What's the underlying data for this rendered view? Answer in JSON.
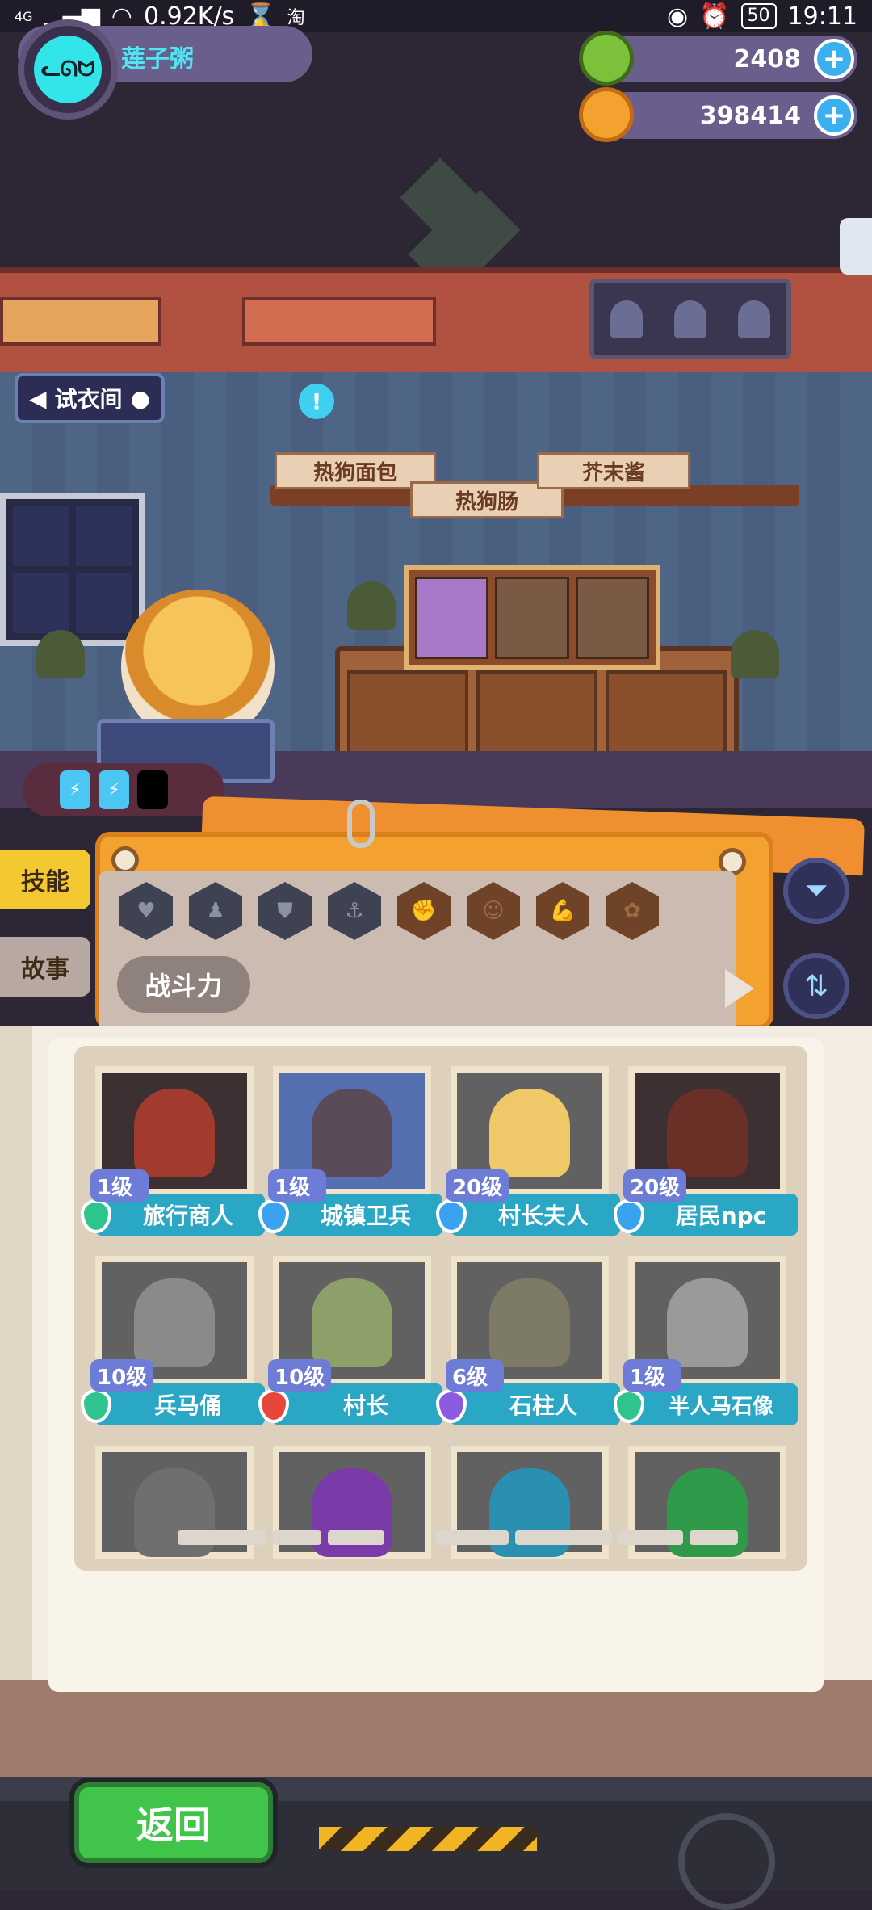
{
  "status_bar": {
    "network": "4G",
    "speed": "0.92K/s",
    "app_badge": "淘",
    "battery": "50",
    "time": "19:11"
  },
  "player": {
    "name": "莲子粥",
    "avatar_icon": "cat-face-icon"
  },
  "currencies": [
    {
      "name": "green-gem-icon",
      "amount": "2408",
      "color": "#7bc23a"
    },
    {
      "name": "orange-planet-icon",
      "amount": "398414",
      "color": "#f4a22f"
    }
  ],
  "scene": {
    "fitting_room_label": "试衣间",
    "signs": {
      "bun": "热狗面包",
      "sausage": "热狗肠",
      "mustard": "芥末酱"
    },
    "alert": "!"
  },
  "info_panel": {
    "tabs": [
      "技能",
      "故事"
    ],
    "hex_icons": [
      "heart-icon",
      "bell-icon",
      "shield-icon",
      "anchor-icon",
      "fist-icon",
      "smile-icon",
      "muscle-icon",
      "brain-icon"
    ],
    "power_label": "战斗力"
  },
  "characters": [
    {
      "level": "1级",
      "name": "旅行商人",
      "shield_color": "#2ec48e"
    },
    {
      "level": "1级",
      "name": "城镇卫兵",
      "shield_color": "#3aa3f0"
    },
    {
      "level": "20级",
      "name": "村长夫人",
      "shield_color": "#3aa3f0"
    },
    {
      "level": "20级",
      "name": "居民npc",
      "shield_color": "#3aa3f0"
    },
    {
      "level": "10级",
      "name": "兵马俑",
      "shield_color": "#2ec48e"
    },
    {
      "level": "10级",
      "name": "村长",
      "shield_color": "#e8463a"
    },
    {
      "level": "6级",
      "name": "石柱人",
      "shield_color": "#8c5ae0"
    },
    {
      "level": "1级",
      "name": "半人马石像",
      "shield_color": "#2ec48e"
    }
  ],
  "bottom": {
    "back_label": "返回"
  }
}
